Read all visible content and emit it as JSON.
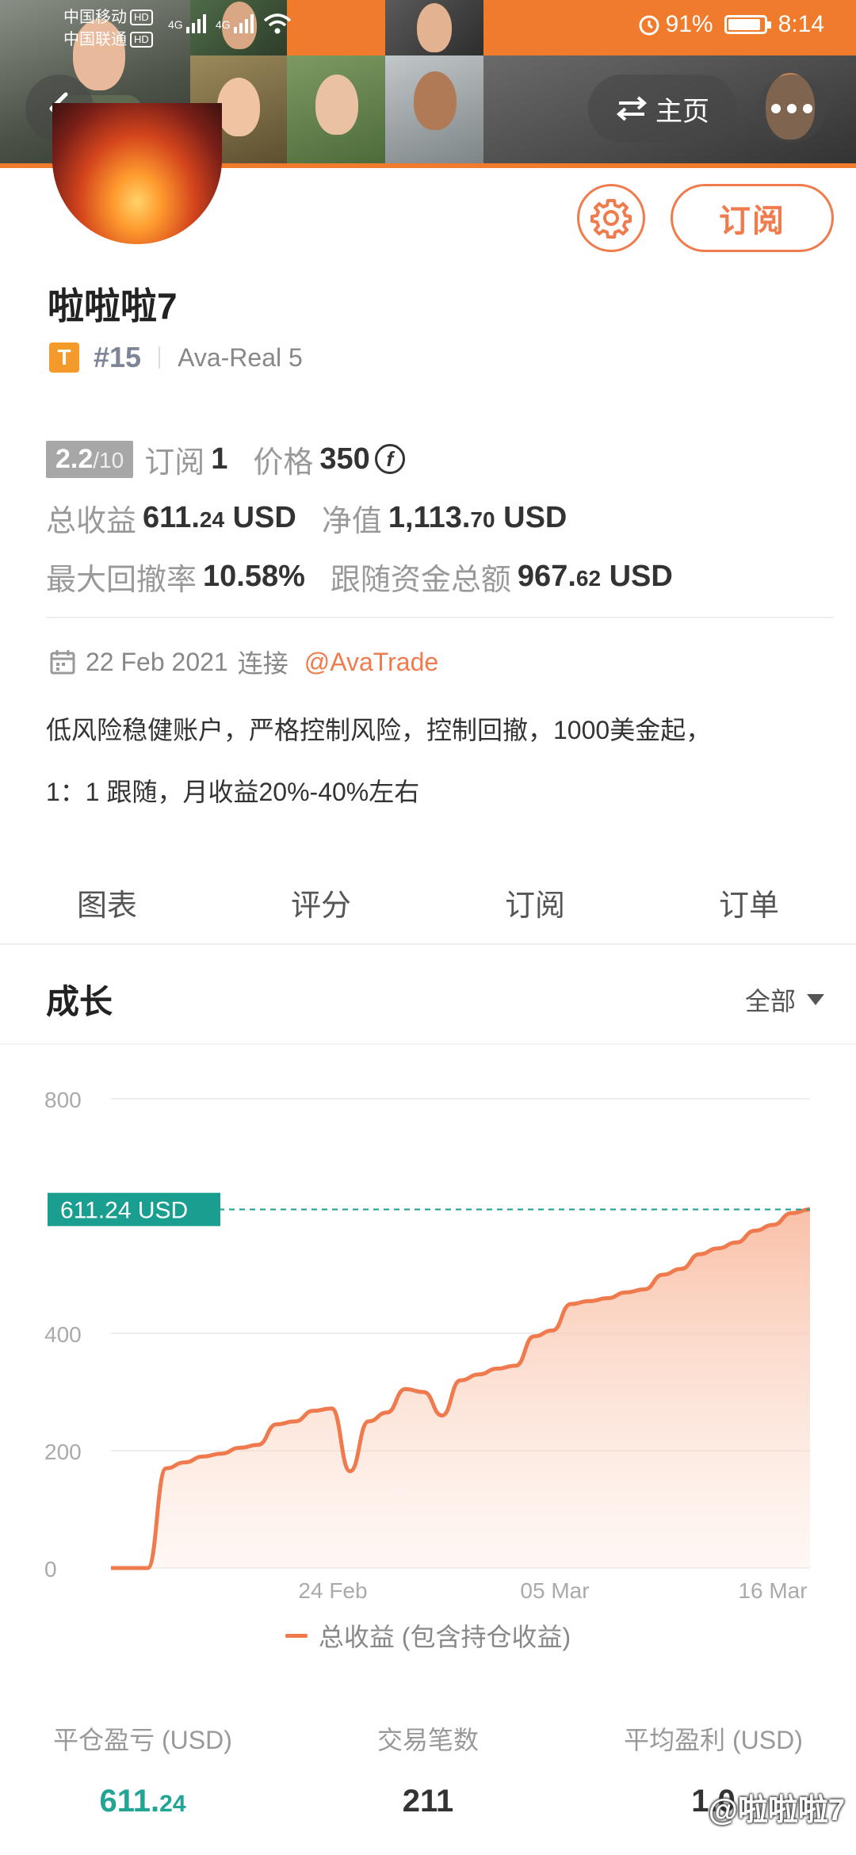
{
  "status_bar": {
    "carrier1": "中国移动",
    "carrier2": "中国联通",
    "hd": "HD",
    "net": "4G",
    "battery": "91%",
    "battery_level": 0.91,
    "time": "8:14"
  },
  "nav": {
    "home_label": "主页"
  },
  "profile": {
    "name": "啦啦啦7",
    "badge": "T",
    "rank": "#15",
    "server": "Ava-Real 5",
    "subscribe_label": "订阅"
  },
  "stats": {
    "score": "2.2",
    "score_max": "/10",
    "subscribe_label": "订阅",
    "subscribe_count": "1",
    "price_label": "价格",
    "price": "350",
    "coin_symbol": "f",
    "total_profit_label": "总收益",
    "total_profit_main": "611.",
    "total_profit_dec": "24",
    "total_profit_unit": "USD",
    "equity_label": "净值",
    "equity_main": "1,113.",
    "equity_dec": "70",
    "equity_unit": "USD",
    "drawdown_label": "最大回撤率",
    "drawdown": "10.58%",
    "follow_label": "跟随资金总额",
    "follow_main": "967.",
    "follow_dec": "62",
    "follow_unit": "USD"
  },
  "connect": {
    "date": "22 Feb 2021",
    "text": "连接",
    "broker": "@AvaTrade"
  },
  "description": {
    "line1": "低风险稳健账户，严格控制风险，控制回撤，1000美金起，",
    "line2": "1：1 跟随，月收益20%-40%左右"
  },
  "tabs": [
    {
      "label": "图表",
      "active": true
    },
    {
      "label": "评分",
      "active": false
    },
    {
      "label": "订阅",
      "active": false
    },
    {
      "label": "订单",
      "active": false
    }
  ],
  "section": {
    "title": "成长",
    "range": "全部"
  },
  "chart_data": {
    "type": "area",
    "y_ticks": [
      "0",
      "200",
      "400",
      "800"
    ],
    "ylim": [
      0,
      800
    ],
    "x_ticks": [
      "24 Feb",
      "05 Mar",
      "16 Mar"
    ],
    "current_value_label": "611.24 USD",
    "current_value": 611.24,
    "series": [
      {
        "name": "总收益 (包含持仓收益)",
        "color": "#ef7a4d",
        "values": [
          0,
          0,
          0,
          170,
          180,
          190,
          195,
          205,
          210,
          245,
          250,
          268,
          272,
          165,
          250,
          265,
          305,
          300,
          260,
          320,
          330,
          340,
          345,
          395,
          405,
          450,
          455,
          460,
          470,
          475,
          500,
          510,
          535,
          545,
          555,
          575,
          585,
          605,
          611.24
        ]
      }
    ]
  },
  "bottom_stats": [
    {
      "label": "平仓盈亏 (USD)",
      "main": "611.",
      "dec": "24",
      "color": "green"
    },
    {
      "label": "交易笔数",
      "main": "211",
      "dec": "",
      "color": "normal"
    },
    {
      "label": "平均盈利 (USD)",
      "main": "1.0",
      "dec": "",
      "color": "normal"
    }
  ],
  "watermark": "@啦啦啦7",
  "colors": {
    "accent": "#f07b4c",
    "green": "#23a596",
    "area_fill": "#fde3d6"
  }
}
